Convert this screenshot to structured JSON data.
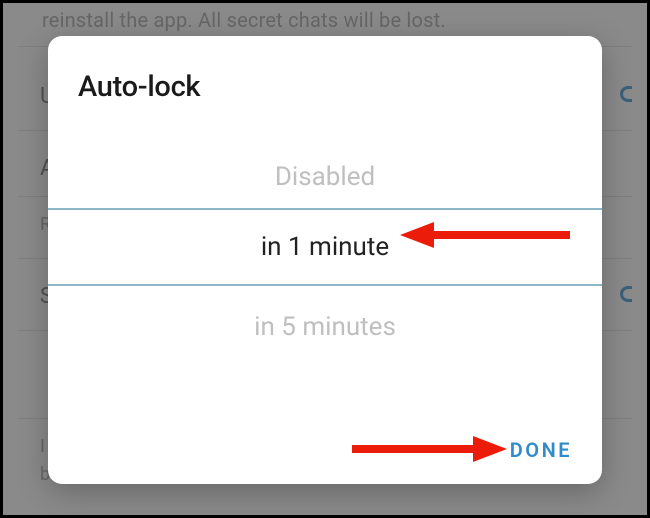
{
  "background": {
    "hint_text": "reinstall the app. All secret chats will be lost.",
    "rows": [
      "U",
      "A",
      "R",
      "S",
      "I",
      "b"
    ]
  },
  "dialog": {
    "title": "Auto-lock",
    "picker": {
      "prev": "Disabled",
      "selected": "in 1 minute",
      "next": "in 5 minutes"
    },
    "done_label": "DONE"
  },
  "colors": {
    "accent": "#2f8bc9",
    "separator": "#8db6c7",
    "arrow": "#ec1c0a"
  }
}
